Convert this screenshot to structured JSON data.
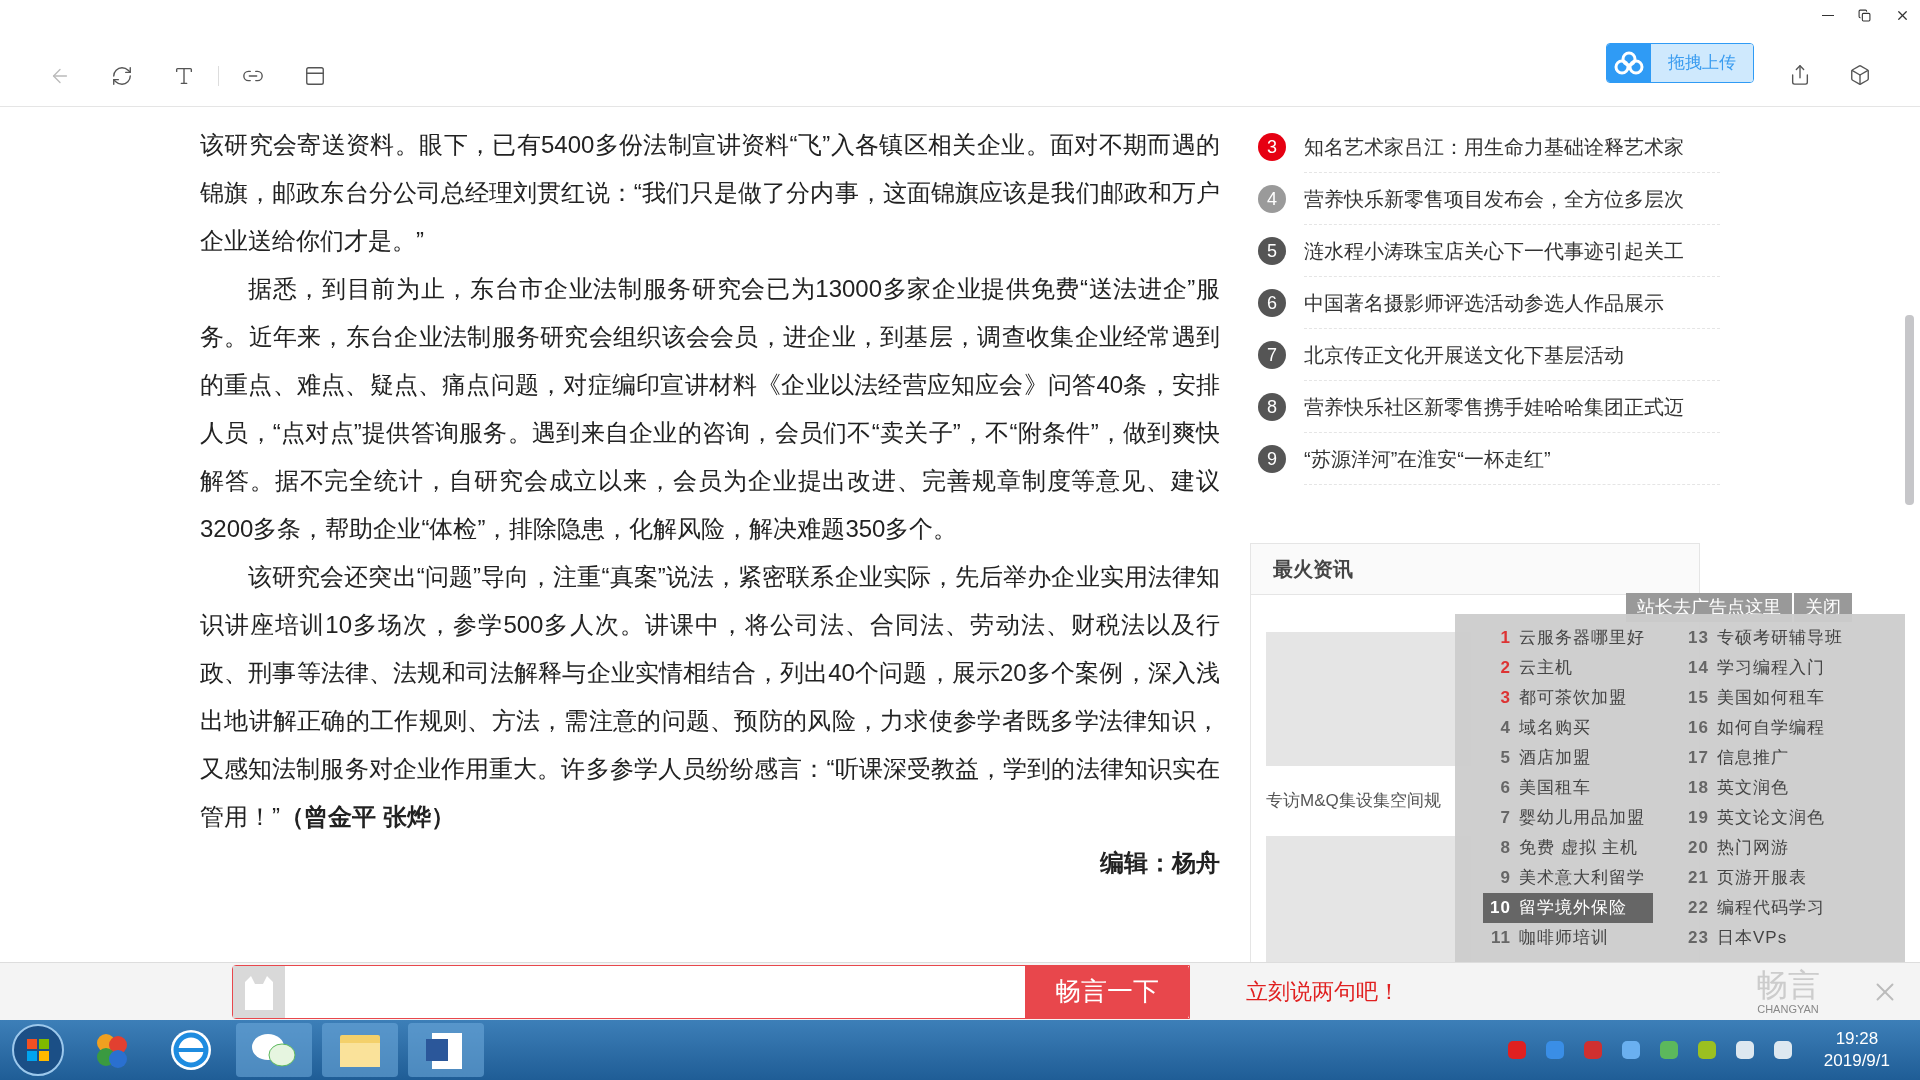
{
  "toolbar": {
    "upload_button": "拖拽上传"
  },
  "article": {
    "paragraphs": [
      {
        "indent": false,
        "text": "该研究会寄送资料。眼下，已有5400多份法制宣讲资料“飞”入各镇区相关企业。面对不期而遇的锦旗，邮政东台分公司总经理刘贯红说：“我们只是做了分内事，这面锦旗应该是我们邮政和万户企业送给你们才是。”"
      },
      {
        "indent": true,
        "text": "据悉，到目前为止，东台市企业法制服务研究会已为13000多家企业提供免费“送法进企”服务。近年来，东台企业法制服务研究会组织该会会员，进企业，到基层，调查收集企业经常遇到的重点、难点、疑点、痛点问题，对症编印宣讲材料《企业以法经营应知应会》问答40条，安排人员，“点对点”提供答询服务。遇到来自企业的咨询，会员们不“卖关子”，不“附条件”，做到爽快解答。据不完全统计，自研究会成立以来，会员为企业提出改进、完善规章制度等意见、建议3200多条，帮助企业“体检”，排除隐患，化解风险，解决难题350多个。"
      },
      {
        "indent": true,
        "text": "该研究会还突出“问题”导向，注重“真案”说法，紧密联系企业实际，先后举办企业实用法律知识讲座培训10多场次，参学500多人次。讲课中，将公司法、合同法、劳动法、财税法以及行政、刑事等法律、法规和司法解释与企业实情相结合，列出40个问题，展示20多个案例，深入浅出地讲解正确的工作规则、方法，需注意的问题、预防的风险，力求使参学者既多学法律知识，又感知法制服务对企业作用重大。许多参学人员纷纷感言：“听课深受教益，学到的法律知识实在管用！”**（曾金平 张烨）**"
      }
    ],
    "editor": "编辑：杨舟"
  },
  "hot_list": [
    {
      "rank": "3",
      "title": "知名艺术家吕江：用生命力基础诠释艺术家",
      "color": "#e60012"
    },
    {
      "rank": "4",
      "title": "营养快乐新零售项目发布会，全方位多层次",
      "color": "#9a9a9a"
    },
    {
      "rank": "5",
      "title": "涟水程小涛珠宝店关心下一代事迹引起关工",
      "color": "#555555"
    },
    {
      "rank": "6",
      "title": "中国著名摄影师评选活动参选人作品展示",
      "color": "#555555"
    },
    {
      "rank": "7",
      "title": "北京传正文化开展送文化下基层活动",
      "color": "#555555"
    },
    {
      "rank": "8",
      "title": "营养快乐社区新零售携手娃哈哈集团正式迈",
      "color": "#555555"
    },
    {
      "rank": "9",
      "title": "“苏源洋河”在淮安“一杯走红”",
      "color": "#555555"
    }
  ],
  "hot_news": {
    "title": "最火资讯",
    "caption": "专访M&Q集设集空间规"
  },
  "ad": {
    "link": "站长去广告点这里",
    "close": "关闭",
    "columns": [
      [
        {
          "rank": "1",
          "label": "云服务器哪里好",
          "hot": true,
          "selected": false
        },
        {
          "rank": "2",
          "label": "云主机",
          "hot": true,
          "selected": false
        },
        {
          "rank": "3",
          "label": "都可茶饮加盟",
          "hot": true,
          "selected": false
        },
        {
          "rank": "4",
          "label": "域名购买",
          "hot": false,
          "selected": false
        },
        {
          "rank": "5",
          "label": "酒店加盟",
          "hot": false,
          "selected": false
        },
        {
          "rank": "6",
          "label": "美国租车",
          "hot": false,
          "selected": false
        },
        {
          "rank": "7",
          "label": "婴幼儿用品加盟",
          "hot": false,
          "selected": false
        },
        {
          "rank": "8",
          "label": "免费 虚拟 主机",
          "hot": false,
          "selected": false
        },
        {
          "rank": "9",
          "label": "美术意大利留学",
          "hot": false,
          "selected": false
        },
        {
          "rank": "10",
          "label": "留学境外保险",
          "hot": false,
          "selected": true
        },
        {
          "rank": "11",
          "label": "咖啡师培训",
          "hot": false,
          "selected": false
        }
      ],
      [
        {
          "rank": "13",
          "label": "专硕考研辅导班",
          "hot": false,
          "selected": false
        },
        {
          "rank": "14",
          "label": "学习编程入门",
          "hot": false,
          "selected": false
        },
        {
          "rank": "15",
          "label": "美国如何租车",
          "hot": false,
          "selected": false
        },
        {
          "rank": "16",
          "label": "如何自学编程",
          "hot": false,
          "selected": false
        },
        {
          "rank": "17",
          "label": "信息推广",
          "hot": false,
          "selected": false
        },
        {
          "rank": "18",
          "label": "英文润色",
          "hot": false,
          "selected": false
        },
        {
          "rank": "19",
          "label": "英文论文润色",
          "hot": false,
          "selected": false
        },
        {
          "rank": "20",
          "label": "热门网游",
          "hot": false,
          "selected": false
        },
        {
          "rank": "21",
          "label": "页游开服表",
          "hot": false,
          "selected": false
        },
        {
          "rank": "22",
          "label": "编程代码学习",
          "hot": false,
          "selected": false
        },
        {
          "rank": "23",
          "label": "日本VPs",
          "hot": false,
          "selected": false
        }
      ]
    ]
  },
  "comment_bar": {
    "button": "畅言一下",
    "prompt": "立刻说两句吧！",
    "brand": "畅言",
    "brand_sub": "CHANGYAN"
  },
  "taskbar": {
    "time": "19:28",
    "date": "2019/9/1"
  }
}
